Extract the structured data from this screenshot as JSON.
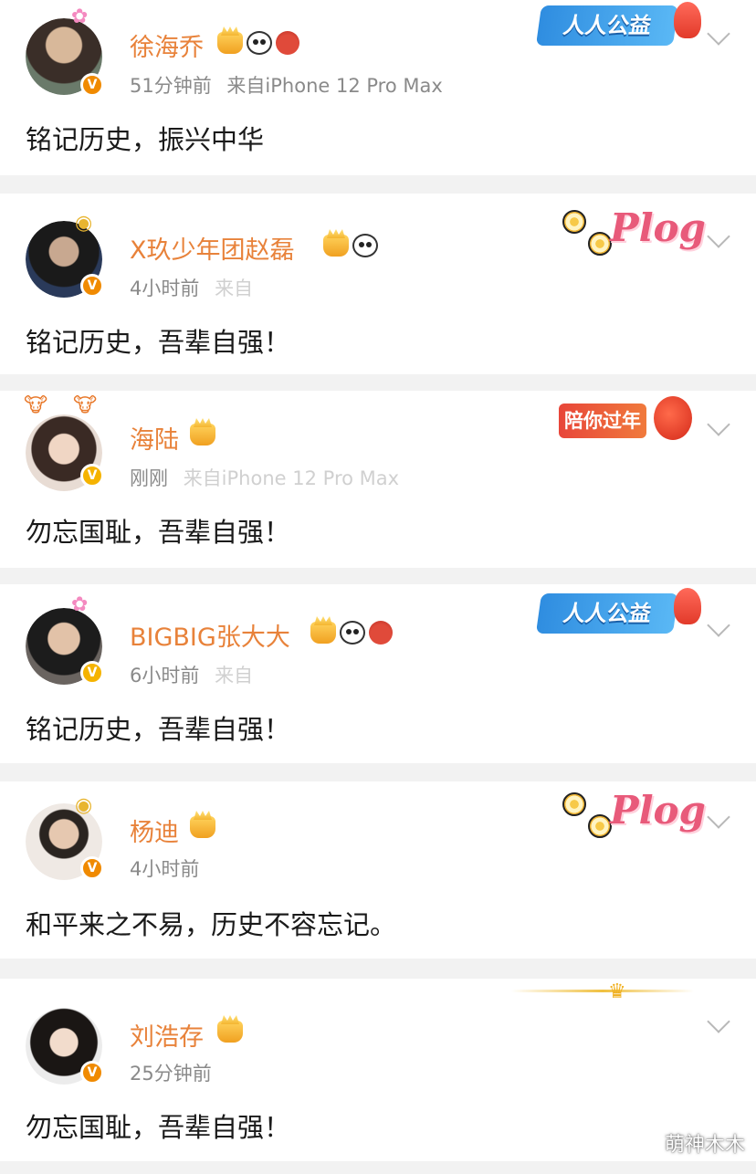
{
  "posts": [
    {
      "name": "徐海乔",
      "time": "51分钟前",
      "source": "来自iPhone 12 Pro Max",
      "text": "铭记历史，振兴中华",
      "card": "人人公益"
    },
    {
      "name": "X玖少年团赵磊",
      "time": "4小时前",
      "source": "来自",
      "text": "铭记历史，吾辈自强！",
      "card": "Plog"
    },
    {
      "name": "海陆",
      "time": "刚刚",
      "source": "来自iPhone 12 Pro Max",
      "text": "勿忘国耻，吾辈自强！",
      "card": "陪你过年"
    },
    {
      "name": "BIGBIG张大大",
      "time": "6小时前",
      "source": "来自",
      "text": "铭记历史，吾辈自强！",
      "card": "人人公益"
    },
    {
      "name": "杨迪",
      "time": "4小时前",
      "source": "",
      "text": "和平来之不易，历史不容忘记。",
      "card": "Plog"
    },
    {
      "name": "刘浩存",
      "time": "25分钟前",
      "source": "",
      "text": "勿忘国耻，吾辈自强！",
      "card": ""
    }
  ],
  "watermark": "萌神木木",
  "colors": {
    "username": "#e8823a",
    "meta": "#8a8a8a",
    "text": "#1a1a1a",
    "separator": "#f2f2f2",
    "verified_orange": "#f08a00",
    "verified_gold": "#f5b300"
  }
}
